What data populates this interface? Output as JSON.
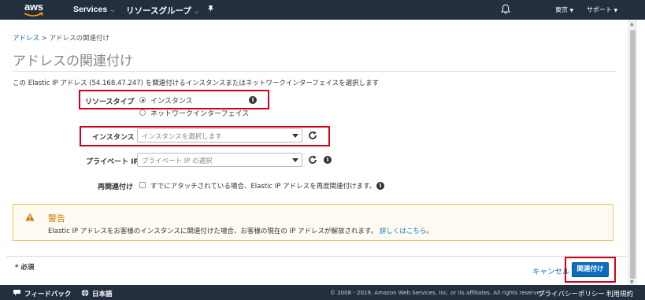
{
  "nav": {
    "logo": "aws",
    "services": "Services",
    "resource_groups": "リソースグループ",
    "region": "東京",
    "support": "サポート"
  },
  "breadcrumb": {
    "link": "アドレス",
    "separator": ">",
    "current": "アドレスの関連付け"
  },
  "page_title": "アドレスの関連付け",
  "description": "この Elastic IP アドレス (54.168.47.247) を関連付けるインスタンスまたはネットワークインターフェイスを選択します",
  "form": {
    "resource_type": {
      "label": "リソースタイプ",
      "options": [
        "インスタンス",
        "ネットワークインターフェイス"
      ],
      "selected": "インスタンス"
    },
    "instance": {
      "label": "インスタンス",
      "placeholder": "インスタンスを選択します"
    },
    "private_ip": {
      "label": "プライベート IP",
      "placeholder": "プライベート IP の選択"
    },
    "reassociate": {
      "label": "再関連付け",
      "text": "すでにアタッチされている場合、Elastic IP アドレスを再度関連付けます。",
      "checked": false
    }
  },
  "warning": {
    "title": "警告",
    "body": "Elastic IP アドレスをお客様のインスタンスに関連付けた場合、お客様の現在の IP アドレスが解放されます。",
    "link": "詳しくはこちら",
    "suffix": "。"
  },
  "required_note": "* 必須",
  "actions": {
    "cancel": "キャンセル",
    "submit": "関連付け"
  },
  "footer": {
    "feedback": "フィードバック",
    "language": "日本語",
    "copyright": "© 2008 - 2019, Amazon Web Services, Inc. or its affiliates. All rights reserved.",
    "privacy": "プライバシーポリシー",
    "terms": "利用規約"
  },
  "colors": {
    "nav_bg": "#232f3e",
    "link": "#0073bb",
    "primary": "#0a6ebd",
    "warning": "#d47500",
    "highlight": "#d0021b"
  },
  "icons": [
    "aws-logo",
    "chevron-down-icon",
    "pin-icon",
    "bell-icon",
    "info-icon",
    "refresh-icon",
    "warning-icon",
    "chat-icon",
    "globe-icon"
  ]
}
